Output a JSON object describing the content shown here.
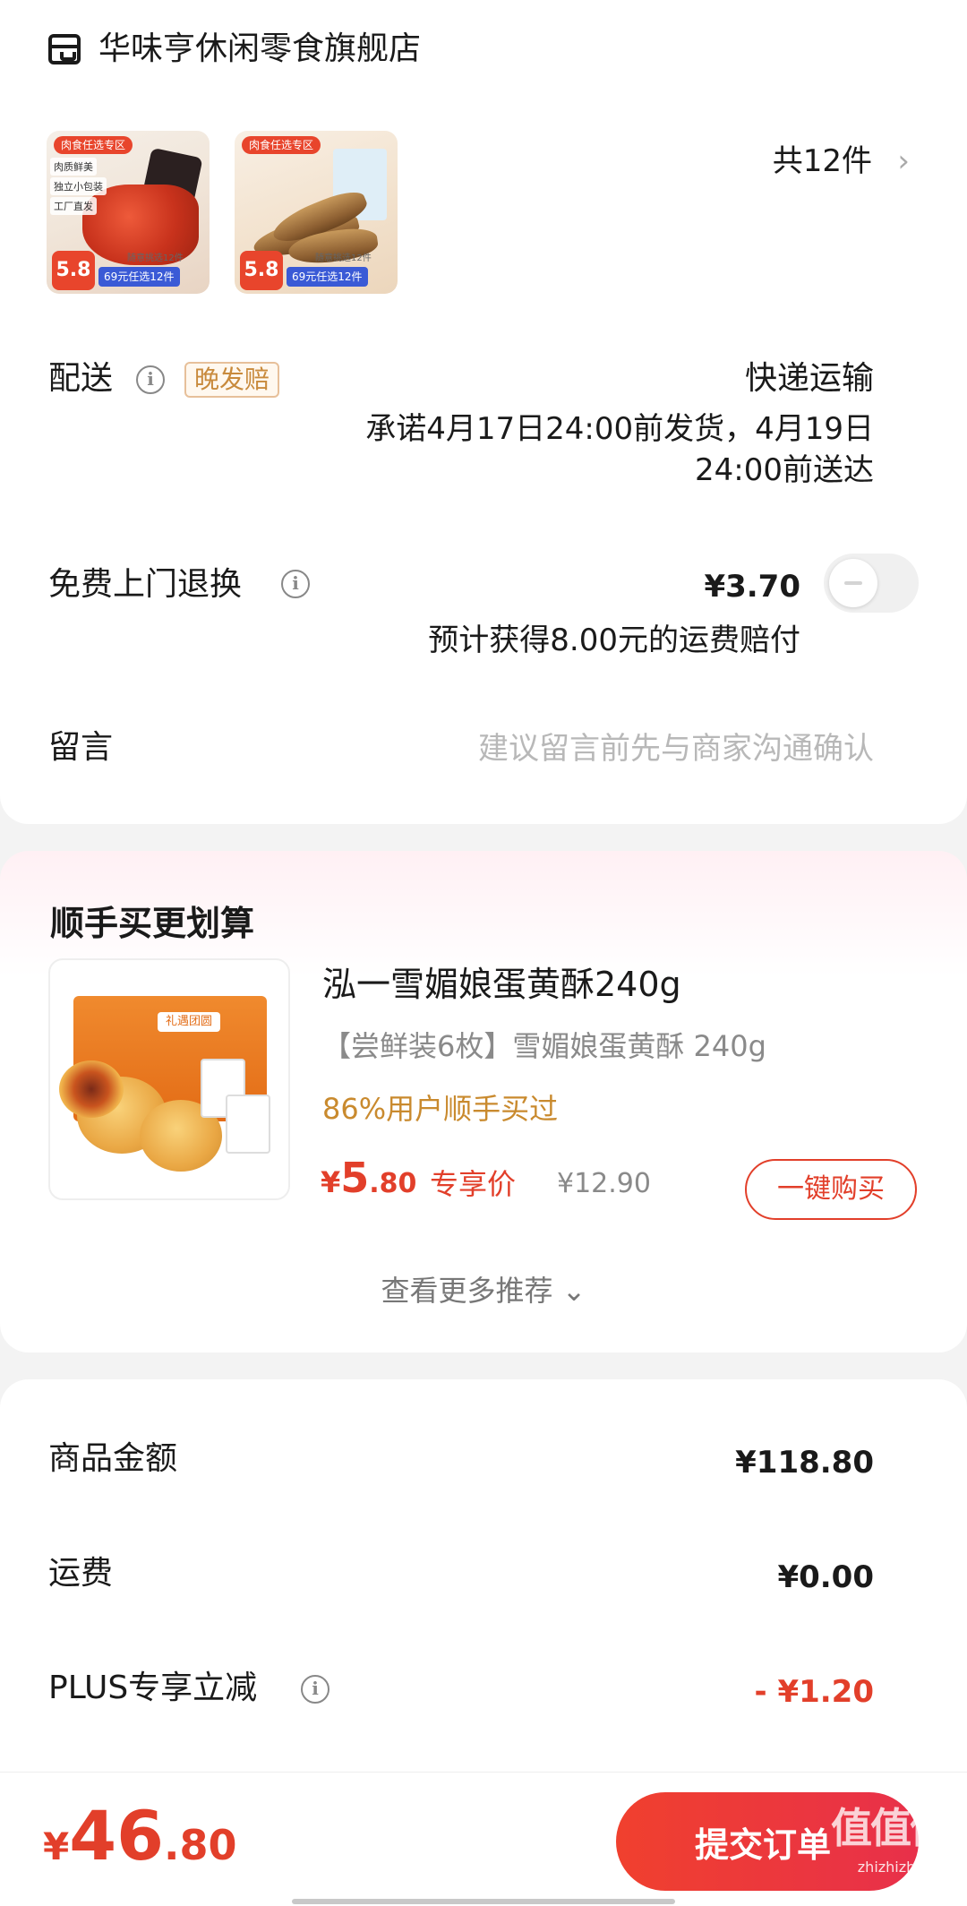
{
  "store": {
    "name": "华味亨休闲零食旗舰店",
    "icon": "store-icon",
    "thumbnails": [
      {
        "tag": "肉食任选专区",
        "lines": [
          "肉质鲜美",
          "独立小包装",
          "工厂直发"
        ],
        "price": "5.8",
        "sub": "随意挑选12件",
        "deal": "69元任选12件"
      },
      {
        "tag": "肉食任选专区",
        "lines": [],
        "price": "5.8",
        "sub": "随意挑选12件",
        "deal": "69元任选12件"
      }
    ],
    "item_count": "共12件"
  },
  "delivery": {
    "label": "配送",
    "badge": "晚发赔",
    "method": "快递运输",
    "promise": "承诺4月17日24:00前发货，4月19日24:00前送达"
  },
  "return_service": {
    "label": "免费上门退换",
    "price": "¥3.70",
    "compensation": "预计获得8.00元的运费赔付",
    "enabled": false
  },
  "note": {
    "label": "留言",
    "placeholder": "建议留言前先与商家沟通确认"
  },
  "upsell": {
    "title": "顺手买更划算",
    "product_name": "泓一雪媚娘蛋黄酥240g",
    "description": "【尝鲜装6枚】雪媚娘蛋黄酥 240g",
    "social_proof": "86%用户顺手买过",
    "price_yen": "¥",
    "price_int": "5",
    "price_dec": ".80",
    "price_tag": "专享价",
    "original_price": "¥12.90",
    "buy_button": "一键购买",
    "box_label": "礼遇团圆",
    "more": "查看更多推荐 ⌄"
  },
  "summary": {
    "goods_label": "商品金额",
    "goods_value": "¥118.80",
    "freight_label": "运费",
    "freight_value": "¥0.00",
    "plus_label": "PLUS专享立减",
    "plus_value": "- ¥1.20"
  },
  "footer": {
    "total_yen": "¥",
    "total_int": "46",
    "total_dec": ".80",
    "submit": "提交订单",
    "watermark": "值值值",
    "watermark_sub": "zhizhizhi.com"
  },
  "colors": {
    "accent": "#e23f2a",
    "social": "#c98a2e",
    "badge": "#c88a3c"
  }
}
